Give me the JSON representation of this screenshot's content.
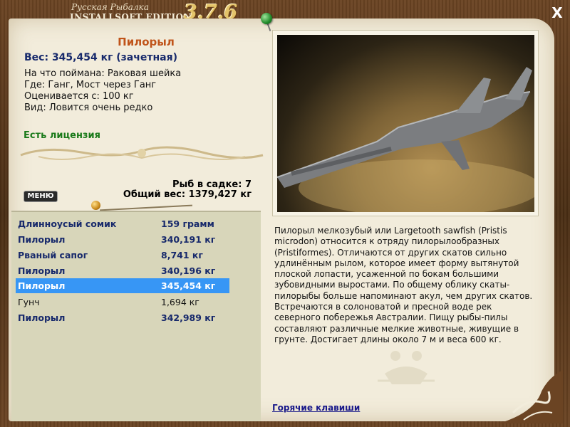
{
  "app": {
    "title_line1": "Русская Рыбалка",
    "title_line2": "INSTALLSOFT EDITION",
    "version": "3.7.6",
    "close_label": "X"
  },
  "fish": {
    "name": "Пилорыл",
    "weight": "Вес: 345,454 кг (зачетная)",
    "caught_on": "На что поймана: Раковая шейка",
    "where": "Где: Ганг, Мост через Ганг",
    "valued_from": "Оценивается с: 100 кг",
    "kind": "Вид: Ловится очень редко",
    "license": "Есть лицензия"
  },
  "cage": {
    "count": "Рыб в садке: 7",
    "total": "Общий вес: 1379,427 кг"
  },
  "menu_label": "МЕНЮ",
  "catch_list": [
    {
      "name": "Длинноусый сомик",
      "weight": "159 грамм",
      "selected": false,
      "style": "bold"
    },
    {
      "name": "Пилорыл",
      "weight": "340,191 кг",
      "selected": false,
      "style": "bold"
    },
    {
      "name": "Рваный сапог",
      "weight": "8,741 кг",
      "selected": false,
      "style": "bold"
    },
    {
      "name": "Пилорыл",
      "weight": "340,196 кг",
      "selected": false,
      "style": "bold"
    },
    {
      "name": "Пилорыл",
      "weight": "345,454 кг",
      "selected": true,
      "style": "bold"
    },
    {
      "name": "Гунч",
      "weight": "1,694 кг",
      "selected": false,
      "style": "plain"
    },
    {
      "name": "Пилорыл",
      "weight": "342,989 кг",
      "selected": false,
      "style": "bold"
    }
  ],
  "description": "Пилорыл мелкозубый или Largetooth sawfish (Pristis microdon) относится к отряду пилорылообразных (Pristiformes). Отличаются от других скатов сильно удлинённым рылом, которое имеет форму вытянутой плоской лопасти, усаженной по бокам большими зубовидными выростами. По общему облику скаты-пилорыбы больше напоминают акул, чем других скатов. Встречаются в солоноватой и пресной воде рек северного побережья Австралии. Пищу рыбы-пилы составляют различные мелкие животные, живущие в грунте. Достигает длины около 7 м и веса 600 кг.",
  "hotkeys_label": "Горячие клавиши",
  "colors": {
    "selection": "#3796f5",
    "fish_name": "#c0541a",
    "license": "#1a7a1a",
    "weight_text": "#17296b"
  }
}
